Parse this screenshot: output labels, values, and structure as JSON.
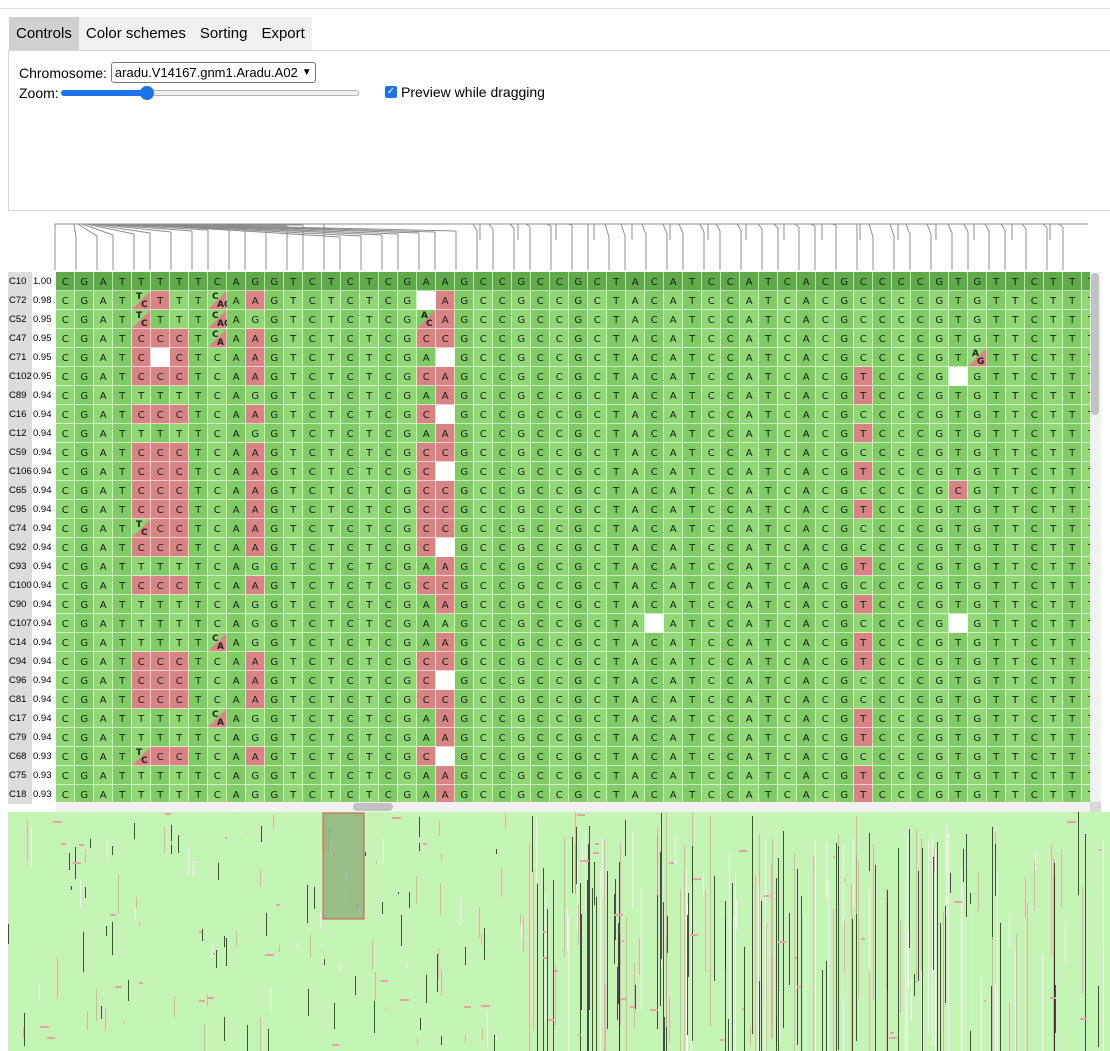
{
  "tabs": [
    {
      "label": "Controls",
      "active": true
    },
    {
      "label": "Color schemes",
      "active": false
    },
    {
      "label": "Sorting",
      "active": false
    },
    {
      "label": "Export",
      "active": false
    }
  ],
  "controls": {
    "chromosome_label": "Chromosome:",
    "chromosome_value": "aradu.V14167.gnm1.Aradu.A02",
    "zoom_label": "Zoom:",
    "zoom_level": 0.29,
    "preview_label": "Preview while dragging",
    "preview_checked": true
  },
  "reference_sequence": "CGATTTTTCAGGTCTCTCGAAGCCGCCGCTACATCCATCACGCCCCGTGTTCTTT",
  "rows": [
    {
      "name": "C10",
      "score": "1.00"
    },
    {
      "name": "C72",
      "score": "0.98"
    },
    {
      "name": "C52",
      "score": "0.95"
    },
    {
      "name": "C47",
      "score": "0.95"
    },
    {
      "name": "C71",
      "score": "0.95"
    },
    {
      "name": "C102",
      "score": "0.95"
    },
    {
      "name": "C89",
      "score": "0.94"
    },
    {
      "name": "C16",
      "score": "0.94"
    },
    {
      "name": "C12",
      "score": "0.94"
    },
    {
      "name": "C59",
      "score": "0.94"
    },
    {
      "name": "C106",
      "score": "0.94"
    },
    {
      "name": "C65",
      "score": "0.94"
    },
    {
      "name": "C95",
      "score": "0.94"
    },
    {
      "name": "C74",
      "score": "0.94"
    },
    {
      "name": "C92",
      "score": "0.94"
    },
    {
      "name": "C93",
      "score": "0.94"
    },
    {
      "name": "C100",
      "score": "0.94"
    },
    {
      "name": "C90",
      "score": "0.94"
    },
    {
      "name": "C107",
      "score": "0.94"
    },
    {
      "name": "C14",
      "score": "0.94"
    },
    {
      "name": "C94",
      "score": "0.94"
    },
    {
      "name": "C96",
      "score": "0.94"
    },
    {
      "name": "C81",
      "score": "0.94"
    },
    {
      "name": "C17",
      "score": "0.94"
    },
    {
      "name": "C79",
      "score": "0.94"
    },
    {
      "name": "C68",
      "score": "0.93"
    },
    {
      "name": "C75",
      "score": "0.93"
    },
    {
      "name": "C18",
      "score": "0.93"
    }
  ],
  "variants": {
    "C72": {
      "4": "T/C",
      "5": "T",
      "8": "C/AG",
      "10": "A",
      "19": "-",
      "20": "A"
    },
    "C52": {
      "4": "T/C",
      "8": "C/AG",
      "19": "A/C",
      "20": "A"
    },
    "C47": {
      "4": "C",
      "5": "C",
      "6": "C",
      "8": "C/A",
      "10": "A",
      "19": "C",
      "20": "C"
    },
    "C71": {
      "4": "C",
      "5": "-",
      "6": "C",
      "10": "A",
      "20": "-",
      "48": "A/G"
    },
    "C102": {
      "4": "C",
      "5": "C",
      "6": "C",
      "10": "A",
      "19": "C",
      "20": "A",
      "42": "T",
      "47": "-"
    },
    "C89": {
      "20": "A",
      "42": "T"
    },
    "C16": {
      "4": "C",
      "5": "C",
      "6": "C",
      "10": "A",
      "19": "C",
      "20": "-"
    },
    "C12": {
      "20": "A",
      "42": "T"
    },
    "C59": {
      "4": "C",
      "5": "C",
      "6": "C",
      "10": "A",
      "19": "C",
      "20": "C"
    },
    "C106": {
      "4": "C",
      "5": "C",
      "6": "C",
      "10": "A",
      "19": "C",
      "20": "-",
      "42": "T"
    },
    "C65": {
      "4": "C",
      "5": "C",
      "6": "C",
      "10": "A",
      "19": "C",
      "20": "C",
      "47": "C"
    },
    "C95": {
      "4": "C",
      "5": "C",
      "6": "C",
      "10": "A",
      "19": "C",
      "20": "C",
      "42": "T"
    },
    "C74": {
      "4": "T/C",
      "5": "C",
      "6": "C",
      "10": "A",
      "19": "C",
      "20": "C"
    },
    "C92": {
      "4": "C",
      "5": "C",
      "6": "C",
      "10": "A",
      "19": "C",
      "20": "-"
    },
    "C93": {
      "20": "A",
      "42": "T"
    },
    "C100": {
      "4": "C",
      "5": "C",
      "6": "C",
      "10": "A",
      "19": "C",
      "20": "C"
    },
    "C90": {
      "20": "A",
      "42": "T"
    },
    "C107": {
      "31": "-",
      "47": "-"
    },
    "C14": {
      "8": "C/A",
      "20": "A",
      "42": "T"
    },
    "C94": {
      "4": "C",
      "5": "C",
      "6": "C",
      "10": "A",
      "19": "C",
      "20": "C",
      "42": "T"
    },
    "C96": {
      "4": "C",
      "5": "C",
      "6": "C",
      "10": "A",
      "19": "C",
      "20": "-"
    },
    "C81": {
      "4": "C",
      "5": "C",
      "6": "C",
      "10": "A",
      "19": "C",
      "20": "C"
    },
    "C17": {
      "8": "C/A",
      "20": "A",
      "42": "T"
    },
    "C79": {
      "20": "A",
      "42": "T"
    },
    "C68": {
      "4": "T/C",
      "5": "C",
      "6": "C",
      "10": "A",
      "19": "C",
      "20": "-"
    },
    "C75": {
      "20": "A",
      "42": "T"
    },
    "C18": {
      "20": "A",
      "42": "T"
    }
  },
  "colors": {
    "match": "#8fd873",
    "match_alt": "#7fcc64",
    "reference": "#5fab48",
    "mismatch": "#d88484",
    "gap": "#ffffff",
    "overview_bg": "#c4f5b4",
    "overview_mismatch": "#e7a3a3",
    "overview_viewport": "#8aa978",
    "accent": "#1a73e8"
  }
}
